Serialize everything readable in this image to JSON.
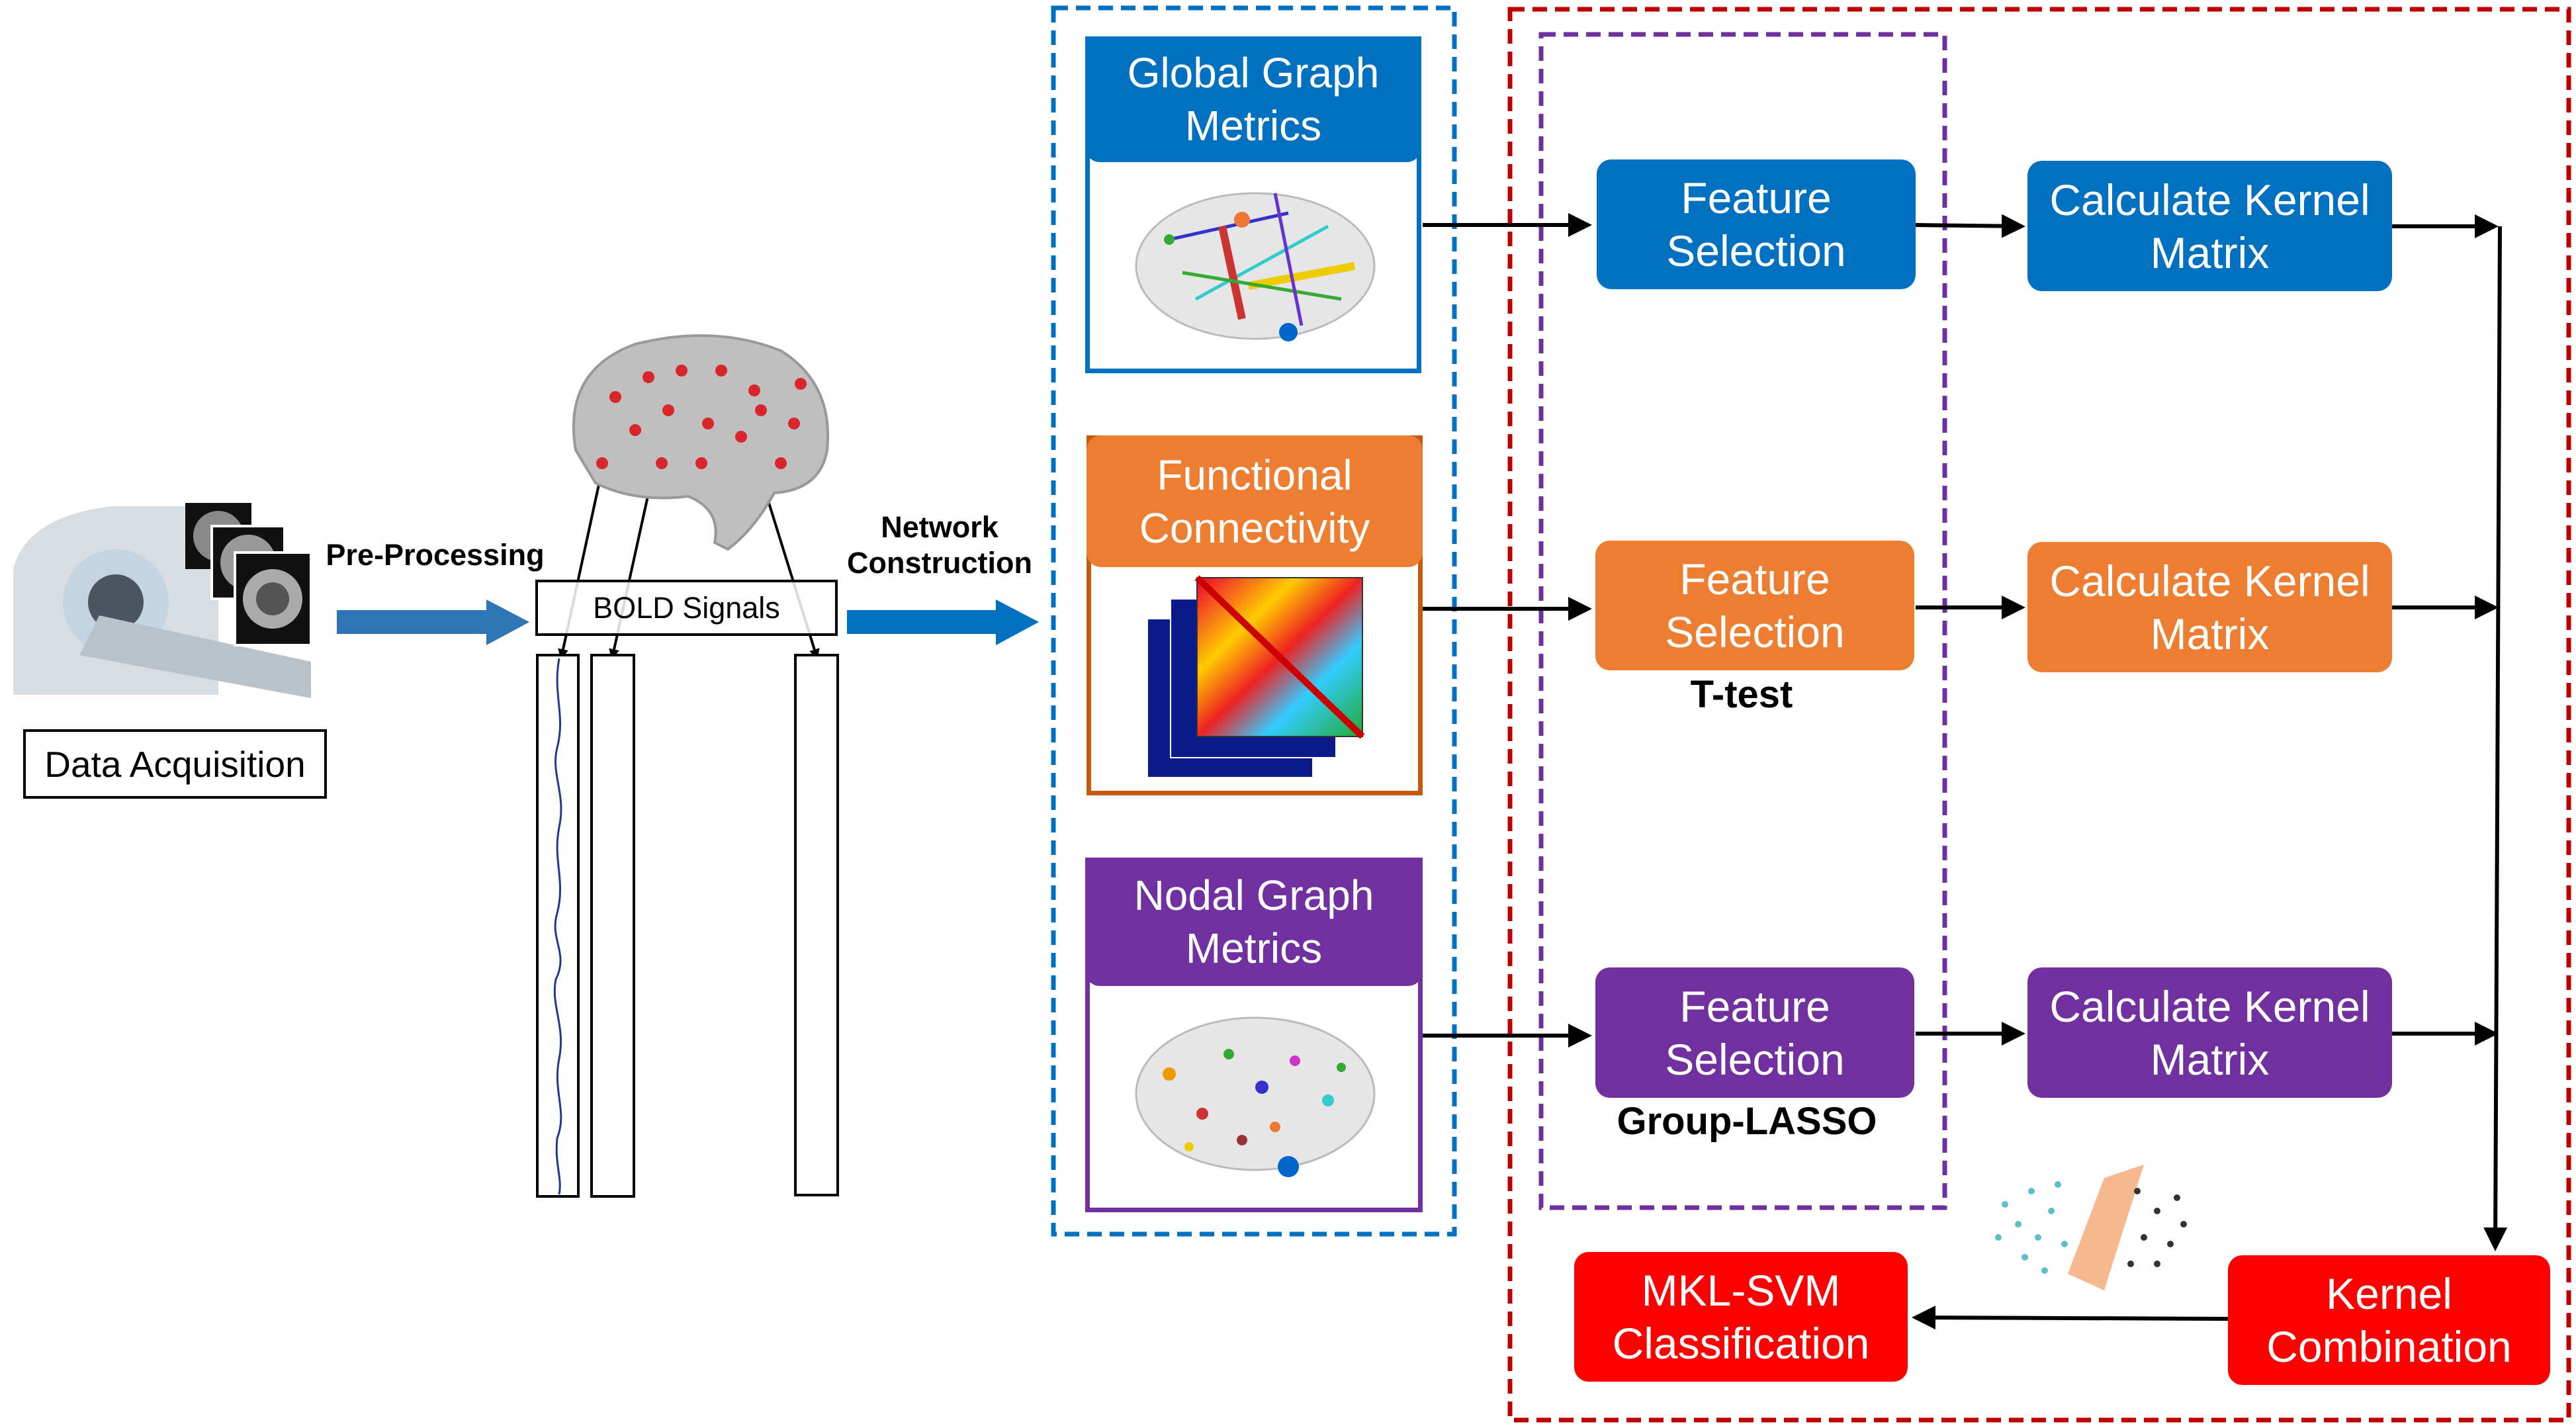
{
  "acquisition": {
    "label": "Data Acquisition"
  },
  "preprocessing": {
    "label": "Pre-Processing"
  },
  "bold": {
    "label": "BOLD Signals"
  },
  "network": {
    "label_line1": "Network",
    "label_line2": "Construction"
  },
  "features": [
    {
      "title": "Global Graph Metrics",
      "color": "#0070C0",
      "icon": "brain-network-icon"
    },
    {
      "title": "Functional Connectivity",
      "color": "#ED7D31",
      "icon": "connectivity-matrix-icon"
    },
    {
      "title": "Nodal Graph Metrics",
      "color": "#7030A0",
      "icon": "brain-nodes-icon"
    }
  ],
  "selection": [
    {
      "label": "Feature Selection",
      "method": ""
    },
    {
      "label": "Feature Selection",
      "method": "T-test"
    },
    {
      "label": "Feature Selection",
      "method": "Group-LASSO"
    }
  ],
  "kernel": [
    {
      "label": "Calculate Kernel Matrix"
    },
    {
      "label": "Calculate Kernel Matrix"
    },
    {
      "label": "Calculate Kernel Matrix"
    }
  ],
  "combination": {
    "label": "Kernel Combination",
    "color": "#FF0000"
  },
  "classification": {
    "label": "MKL-SVM Classification",
    "color": "#FF0000"
  },
  "colors": {
    "blue": "#0070C0",
    "orange": "#ED7D31",
    "purple": "#7030A0",
    "red": "#FF0000",
    "dark_red": "#C00000"
  }
}
